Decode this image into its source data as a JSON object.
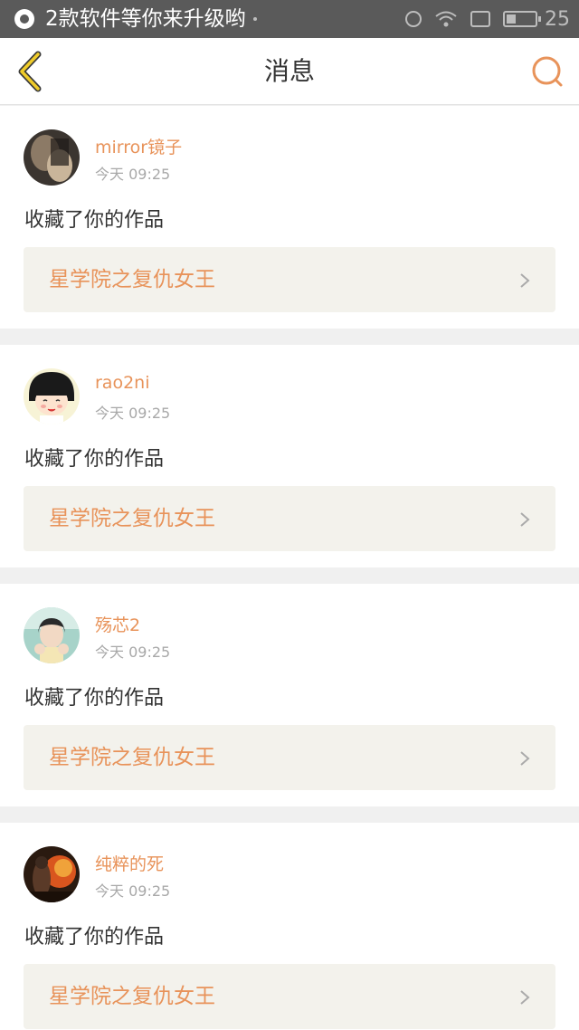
{
  "status_bar": {
    "notification_text": "2款软件等你来升级哟",
    "battery_level": "25",
    "icons": [
      "app-notification-icon",
      "alarm-icon",
      "wifi-icon",
      "phone-icon",
      "battery-icon"
    ]
  },
  "header": {
    "title": "消息",
    "back_icon": "chevron-left-icon",
    "search_icon": "search-icon"
  },
  "colors": {
    "accent": "#e8935a",
    "back_icon": "#f0cc2a",
    "card_bg": "#ffffff",
    "page_bg": "#f0f0f0",
    "link_bg": "#f3f2ec"
  },
  "messages": [
    {
      "user": "mirror镜子",
      "time": "今天 09:25",
      "text": "收藏了你的作品",
      "work": "星学院之复仇女王"
    },
    {
      "user": "rao2ni",
      "time": "今天 09:25",
      "text": "收藏了你的作品",
      "work": "星学院之复仇女王"
    },
    {
      "user": "殇芯2",
      "time": "今天 09:25",
      "text": "收藏了你的作品",
      "work": "星学院之复仇女王"
    },
    {
      "user": "纯粹的死",
      "time": "今天 09:25",
      "text": "收藏了你的作品",
      "work": "星学院之复仇女王"
    }
  ]
}
